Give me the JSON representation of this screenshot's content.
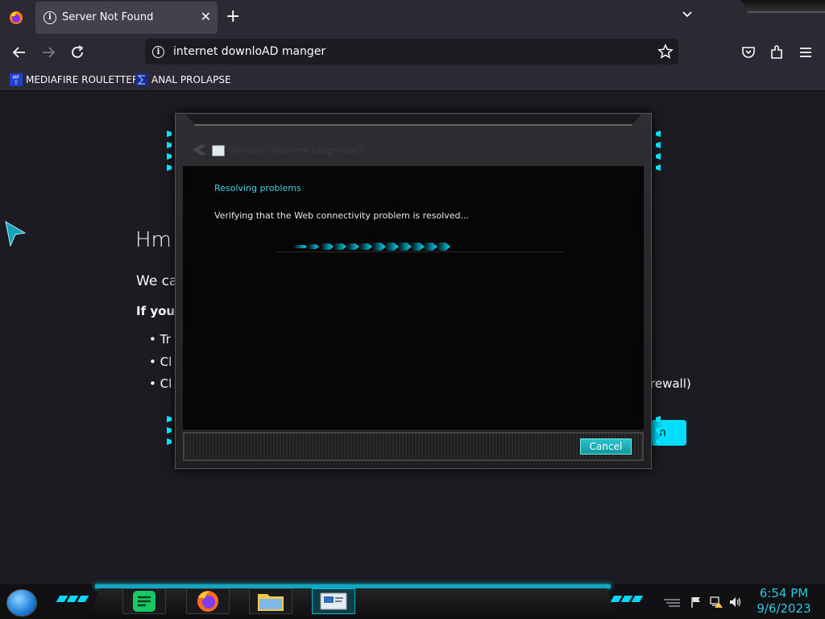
{
  "browser": {
    "tab": {
      "title": "Server Not Found"
    },
    "url": "internet downloAD manger",
    "bookmarks": [
      {
        "label": "MEDIAFIRE ROULETTER"
      },
      {
        "label": "ANAL PROLAPSE"
      }
    ]
  },
  "page": {
    "heading": "Hm",
    "para1": "We ca",
    "para2": "If you",
    "bullets": [
      "Tr",
      "Cl",
      "Cl"
    ],
    "trailing_text": "rewall)",
    "button_fragment": "n"
  },
  "dialog": {
    "title": "Windows Network Diagnostics",
    "heading": "Resolving problems",
    "status": "Verifying that the Web connectivity problem is resolved...",
    "cancel_label": "Cancel"
  },
  "taskbar": {
    "time": "6:54 PM",
    "date": "9/6/2023",
    "apps": [
      "notes-app-icon",
      "firefox-icon",
      "file-explorer-icon",
      "network-diagnostics-icon"
    ]
  },
  "colors": {
    "accent": "#00ddff",
    "dialog_accent": "#3fd3e6",
    "clock": "#28c7e0"
  }
}
